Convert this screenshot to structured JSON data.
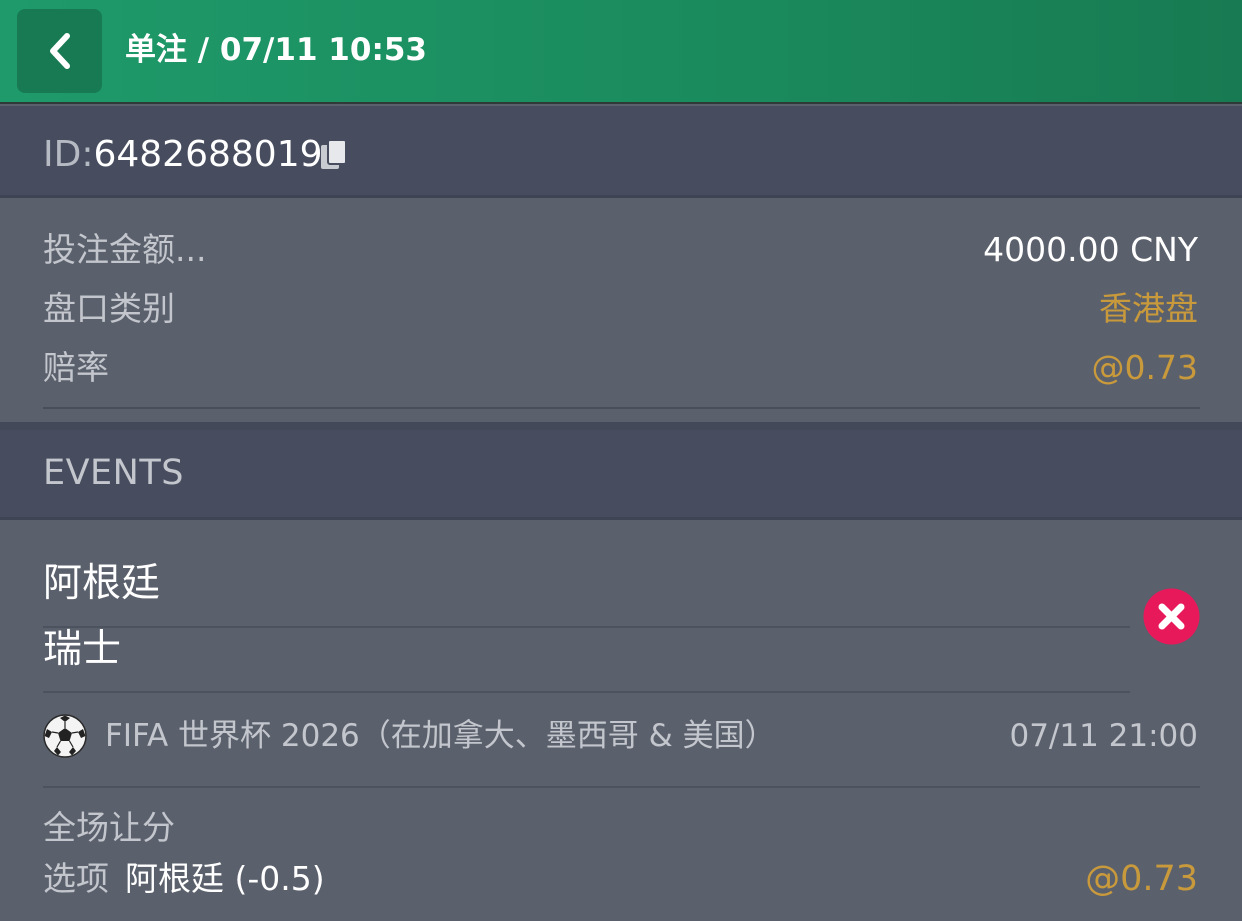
{
  "header": {
    "title": "单注 / 07/11 10:53",
    "back_icon": "chevron-left-icon"
  },
  "bet_id": {
    "label": "ID:",
    "value": "6482688019",
    "copy_icon": "copy-icon"
  },
  "summary": {
    "stake_label": "投注金额...",
    "stake_value": "4000.00 CNY",
    "odds_type_label": "盘口类别",
    "odds_type_value": "香港盘",
    "odds_label": "赔率",
    "odds_value": "@0.73"
  },
  "events": {
    "section_label": "EVENTS",
    "home_team": "阿根廷",
    "away_team": "瑞士",
    "status_icon": "cancel-x-icon",
    "sport_icon": "soccer-ball-icon",
    "league": "FIFA 世界杯 2026（在加拿大、墨西哥 & 美国）",
    "match_time": "07/11 21:00",
    "market": "全场让分",
    "selection_label": "选项",
    "selection_value": "阿根廷 (-0.5)",
    "selection_odds": "@0.73"
  },
  "colors": {
    "header_green": "#1f9a6a",
    "accent_gold": "#c99a3c",
    "cancel_red": "#e8195a",
    "panel_dark": "#474d5f",
    "panel": "#5a606c"
  }
}
